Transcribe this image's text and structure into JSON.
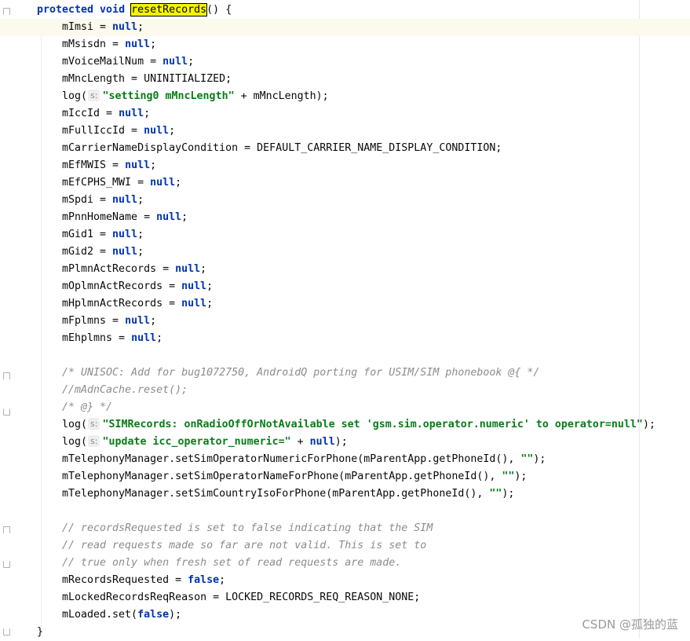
{
  "editor": {
    "lines": [
      {
        "tokens": [
          {
            "t": "protected void ",
            "c": "kw"
          },
          {
            "t": "resetRecords",
            "c": "hl"
          },
          {
            "t": "() {"
          }
        ],
        "indent": 0
      },
      {
        "tokens": [
          {
            "t": "mImsi = "
          },
          {
            "t": "null",
            "c": "kw"
          },
          {
            "t": ";"
          }
        ],
        "current": true
      },
      {
        "tokens": [
          {
            "t": "mMsisdn = "
          },
          {
            "t": "null",
            "c": "kw"
          },
          {
            "t": ";"
          }
        ]
      },
      {
        "tokens": [
          {
            "t": "mVoiceMailNum = "
          },
          {
            "t": "null",
            "c": "kw"
          },
          {
            "t": ";"
          }
        ]
      },
      {
        "tokens": [
          {
            "t": "mMncLength = UNINITIALIZED;"
          }
        ]
      },
      {
        "tokens": [
          {
            "t": "log("
          },
          {
            "t": "s:",
            "c": "hint"
          },
          {
            "t": "\"setting0 mMncLength\"",
            "c": "str"
          },
          {
            "t": " + mMncLength);"
          }
        ]
      },
      {
        "tokens": [
          {
            "t": "mIccId = "
          },
          {
            "t": "null",
            "c": "kw"
          },
          {
            "t": ";"
          }
        ]
      },
      {
        "tokens": [
          {
            "t": "mFullIccId = "
          },
          {
            "t": "null",
            "c": "kw"
          },
          {
            "t": ";"
          }
        ]
      },
      {
        "tokens": [
          {
            "t": "mCarrierNameDisplayCondition = DEFAULT_CARRIER_NAME_DISPLAY_CONDITION;"
          }
        ]
      },
      {
        "tokens": [
          {
            "t": "mEfMWIS = "
          },
          {
            "t": "null",
            "c": "kw"
          },
          {
            "t": ";"
          }
        ]
      },
      {
        "tokens": [
          {
            "t": "mEfCPHS_MWI = "
          },
          {
            "t": "null",
            "c": "kw"
          },
          {
            "t": ";"
          }
        ]
      },
      {
        "tokens": [
          {
            "t": "mSpdi = "
          },
          {
            "t": "null",
            "c": "kw"
          },
          {
            "t": ";"
          }
        ]
      },
      {
        "tokens": [
          {
            "t": "mPnnHomeName = "
          },
          {
            "t": "null",
            "c": "kw"
          },
          {
            "t": ";"
          }
        ]
      },
      {
        "tokens": [
          {
            "t": "mGid1 = "
          },
          {
            "t": "null",
            "c": "kw"
          },
          {
            "t": ";"
          }
        ]
      },
      {
        "tokens": [
          {
            "t": "mGid2 = "
          },
          {
            "t": "null",
            "c": "kw"
          },
          {
            "t": ";"
          }
        ]
      },
      {
        "tokens": [
          {
            "t": "mPlmnActRecords = "
          },
          {
            "t": "null",
            "c": "kw"
          },
          {
            "t": ";"
          }
        ]
      },
      {
        "tokens": [
          {
            "t": "mOplmnActRecords = "
          },
          {
            "t": "null",
            "c": "kw"
          },
          {
            "t": ";"
          }
        ]
      },
      {
        "tokens": [
          {
            "t": "mHplmnActRecords = "
          },
          {
            "t": "null",
            "c": "kw"
          },
          {
            "t": ";"
          }
        ]
      },
      {
        "tokens": [
          {
            "t": "mFplmns = "
          },
          {
            "t": "null",
            "c": "kw"
          },
          {
            "t": ";"
          }
        ]
      },
      {
        "tokens": [
          {
            "t": "mEhplmns = "
          },
          {
            "t": "null",
            "c": "kw"
          },
          {
            "t": ";"
          }
        ]
      },
      {
        "tokens": []
      },
      {
        "tokens": [
          {
            "t": "/* UNISOC: Add for bug1072750, AndroidQ porting for USIM/SIM phonebook @{ */",
            "c": "cmt"
          }
        ]
      },
      {
        "tokens": [
          {
            "t": "//mAdnCache.reset();",
            "c": "cmt"
          }
        ]
      },
      {
        "tokens": [
          {
            "t": "/* @} */",
            "c": "cmt"
          }
        ]
      },
      {
        "tokens": [
          {
            "t": "log("
          },
          {
            "t": "s:",
            "c": "hint"
          },
          {
            "t": "\"SIMRecords: onRadioOffOrNotAvailable set 'gsm.sim.operator.numeric' to operator=null\"",
            "c": "str"
          },
          {
            "t": ");"
          }
        ]
      },
      {
        "tokens": [
          {
            "t": "log("
          },
          {
            "t": "s:",
            "c": "hint"
          },
          {
            "t": "\"update icc_operator_numeric=\"",
            "c": "str"
          },
          {
            "t": " + "
          },
          {
            "t": "null",
            "c": "kw"
          },
          {
            "t": ");"
          }
        ]
      },
      {
        "tokens": [
          {
            "t": "mTelephonyManager.setSimOperatorNumericForPhone(mParentApp.getPhoneId(), "
          },
          {
            "t": "\"\"",
            "c": "str"
          },
          {
            "t": ");"
          }
        ]
      },
      {
        "tokens": [
          {
            "t": "mTelephonyManager.setSimOperatorNameForPhone(mParentApp.getPhoneId(), "
          },
          {
            "t": "\"\"",
            "c": "str"
          },
          {
            "t": ");"
          }
        ]
      },
      {
        "tokens": [
          {
            "t": "mTelephonyManager.setSimCountryIsoForPhone(mParentApp.getPhoneId(), "
          },
          {
            "t": "\"\"",
            "c": "str"
          },
          {
            "t": ");"
          }
        ]
      },
      {
        "tokens": []
      },
      {
        "tokens": [
          {
            "t": "// recordsRequested is set to false indicating that the SIM",
            "c": "cmt"
          }
        ]
      },
      {
        "tokens": [
          {
            "t": "// read requests made so far are not valid. This is set to",
            "c": "cmt"
          }
        ]
      },
      {
        "tokens": [
          {
            "t": "// true only when fresh set of read requests are made.",
            "c": "cmt"
          }
        ]
      },
      {
        "tokens": [
          {
            "t": "mRecordsRequested = "
          },
          {
            "t": "false",
            "c": "kw"
          },
          {
            "t": ";"
          }
        ]
      },
      {
        "tokens": [
          {
            "t": "mLockedRecordsReqReason = LOCKED_RECORDS_REQ_REASON_NONE;"
          }
        ]
      },
      {
        "tokens": [
          {
            "t": "mLoaded.set("
          },
          {
            "t": "false",
            "c": "kw"
          },
          {
            "t": ");"
          }
        ]
      },
      {
        "tokens": [
          {
            "t": "}"
          }
        ],
        "indent": 0
      }
    ]
  },
  "watermark": "CSDN @孤独的蓝",
  "colors": {
    "keyword": "#0033b3",
    "string": "#067d17",
    "comment": "#8c8c8c",
    "highlight": "#f5f500",
    "current_line": "#fcfaed"
  }
}
